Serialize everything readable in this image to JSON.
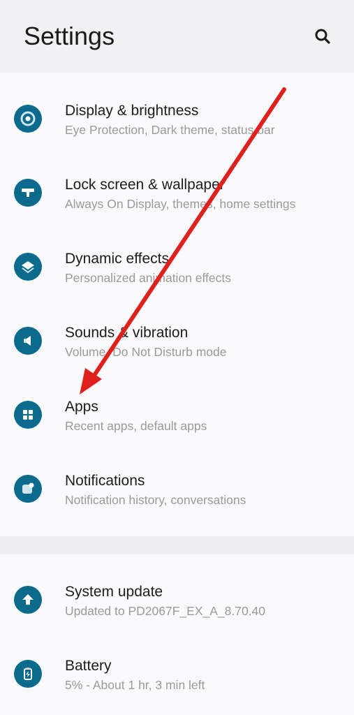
{
  "header": {
    "title": "Settings",
    "search_icon": "search-icon"
  },
  "group1": [
    {
      "title": "Display & brightness",
      "subtitle": "Eye Protection, Dark theme, status bar",
      "icon": "display-icon"
    },
    {
      "title": "Lock screen & wallpaper",
      "subtitle": "Always On Display, themes, home settings",
      "icon": "lock-screen-icon"
    },
    {
      "title": "Dynamic effects",
      "subtitle": "Personalized animation effects",
      "icon": "layers-icon"
    },
    {
      "title": "Sounds & vibration",
      "subtitle": "Volume, Do Not Disturb mode",
      "icon": "speaker-icon"
    },
    {
      "title": "Apps",
      "subtitle": "Recent apps, default apps",
      "icon": "apps-grid-icon"
    },
    {
      "title": "Notifications",
      "subtitle": "Notification history, conversations",
      "icon": "notification-icon"
    }
  ],
  "group2": [
    {
      "title": "System update",
      "subtitle": "Updated to PD2067F_EX_A_8.70.40",
      "icon": "upload-arrow-icon"
    },
    {
      "title": "Battery",
      "subtitle": "5% - About 1 hr, 3 min left",
      "icon": "battery-icon"
    }
  ],
  "colors": {
    "icon_bg": "#0c6a8c",
    "annotation_arrow": "#e0201c",
    "header_bg": "#f1f1f3"
  }
}
